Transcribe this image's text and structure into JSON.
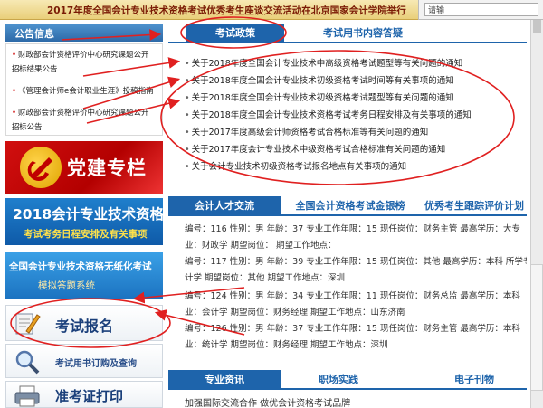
{
  "top_banner": {
    "text": "2017年度全国会计专业技术资格考试优秀考生座谈交流活动在北京国家会计学院举行",
    "search_value": "请输"
  },
  "notices": {
    "title": "公告信息",
    "items": [
      "财政部会计资格评价中心研究课题公开招",
      "标结果公告",
      "《管理会计师e会计职业生涯》投稿指南",
      "财政部会计资格评价中心研究课题公开招",
      "标公告"
    ]
  },
  "party": {
    "label": "党建专栏"
  },
  "exam_banner": {
    "title": "2018会计专业技术资格",
    "subtitle": "考试考务日程安排及有关事项"
  },
  "pc_banner": {
    "title": "全国会计专业技术资格无纸化考试",
    "subtitle": "模拟答题系统"
  },
  "side_links": {
    "register": "考试报名",
    "books": "考试用书订购及查询",
    "ticket": "准考证打印"
  },
  "policy_tabs": [
    "考试政策",
    "考试用书内容答疑"
  ],
  "policy_items": [
    "关于2018年度全国会计专业技术中高级资格考试题型等有关问题的通知",
    "关于2018年度全国会计专业技术初级资格考试时间等有关事项的通知",
    "关于2018年度全国会计专业技术初级资格考试题型等有关问题的通知",
    "关于2018年度全国会计专业技术资格考试考务日程安排及有关事项的通知",
    "关于2017年度高级会计师资格考试合格标准等有关问题的通知",
    "关于2017年度会计专业技术中级资格考试合格标准有关问题的通知",
    "关于会计专业技术初级资格考试报名地点有关事项的通知"
  ],
  "talent_tabs": [
    "会计人才交流",
    "全国会计资格考试金银榜",
    "优秀考生跟踪评价计划"
  ],
  "talent_lines": [
    "编号：116 性别：男 年龄：37 专业工作年限：15 现任岗位：财务主管 最高学历：大专",
    "业：财政学  期望岗位：  期望工作地点：",
    "编号：117 性别：男 年龄：39 专业工作年限：15 现任岗位：其他 最高学历：本科 所学专业：",
    "计学  期望岗位：其他  期望工作地点：深圳",
    "编号：124 性别：男 年龄：34 专业工作年限：11 现任岗位：财务总监 最高学历：本科",
    "业：会计学  期望岗位：财务经理  期望工作地点：山东济南",
    "编号：126 性别：男 年龄：37 专业工作年限：15 现任岗位：财务主管 最高学历：本科",
    "业：统计学  期望岗位：财务经理  期望工作地点：深圳"
  ],
  "news_tabs": [
    "专业资讯",
    "职场实践",
    "电子刊物"
  ],
  "news_first": "加强国际交流合作 做优会计资格考试品牌",
  "colors": {
    "tab_blue": "#1e64ab",
    "party_red": "#c00000",
    "annotation_red": "#e02020"
  }
}
